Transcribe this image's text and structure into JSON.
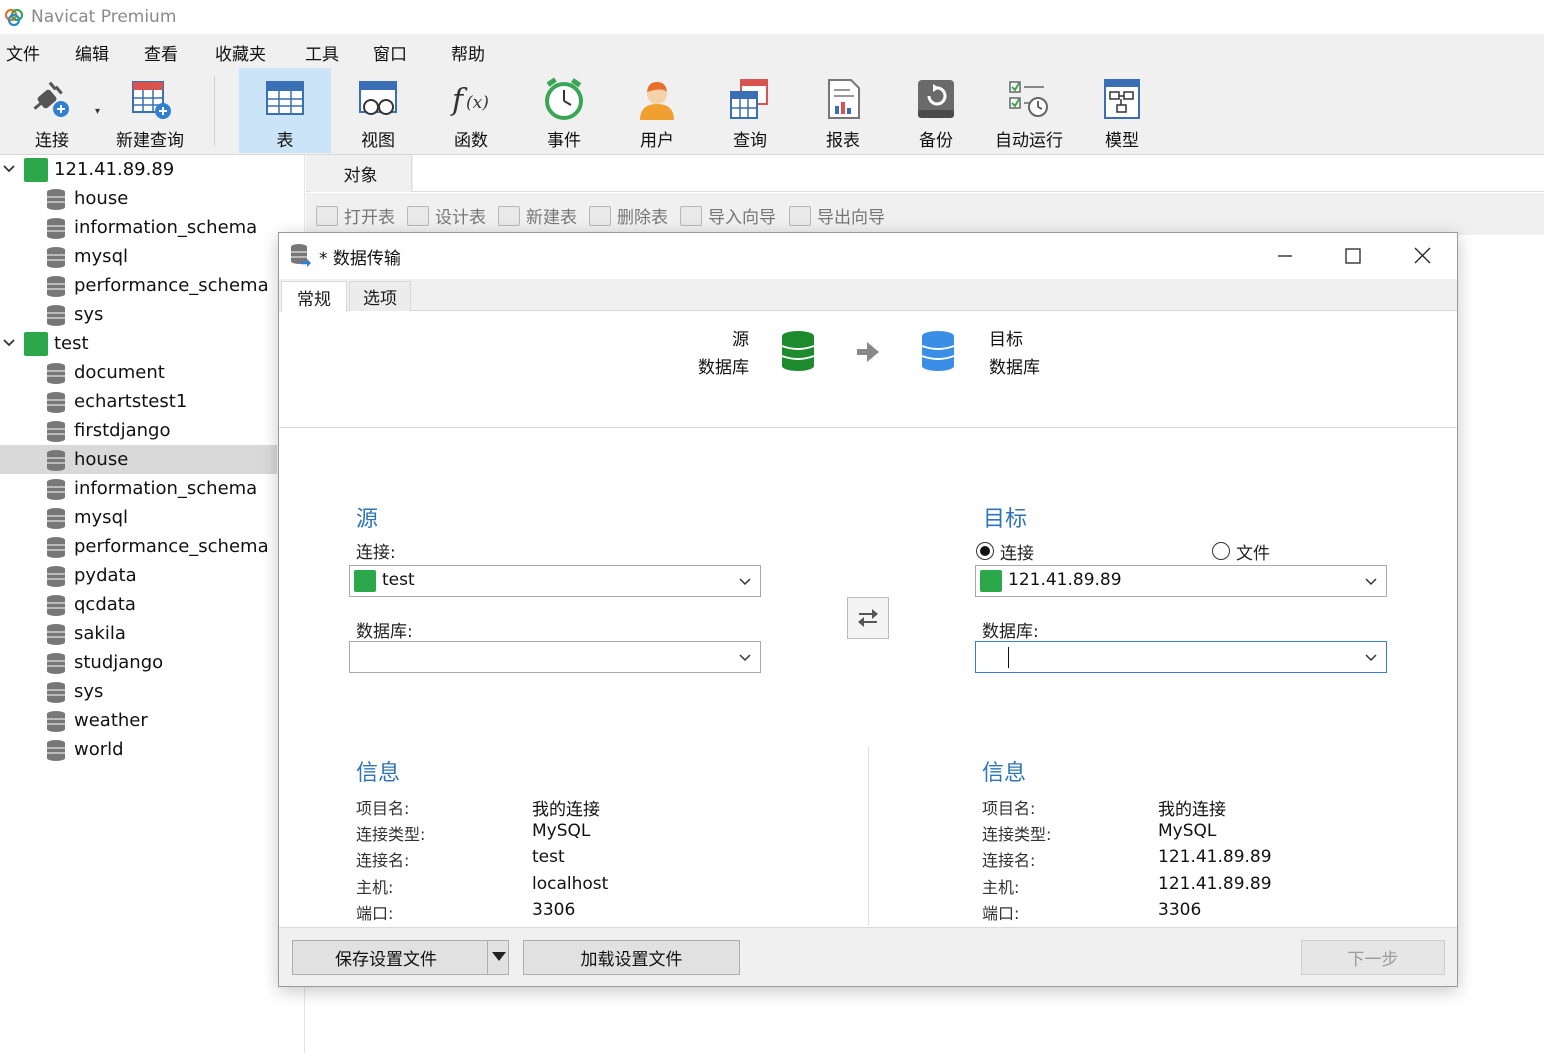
{
  "app": {
    "title": "Navicat Premium"
  },
  "menu": [
    "文件",
    "编辑",
    "查看",
    "收藏夹",
    "工具",
    "窗口",
    "帮助"
  ],
  "toolbar": {
    "items": [
      {
        "label": "连接",
        "icon": "plug-connect-icon"
      },
      {
        "label": "新建查询",
        "icon": "new-query-icon"
      },
      {
        "label": "表",
        "icon": "table-icon",
        "active": true
      },
      {
        "label": "视图",
        "icon": "view-icon"
      },
      {
        "label": "函数",
        "icon": "function-icon"
      },
      {
        "label": "事件",
        "icon": "alarm-clock-icon"
      },
      {
        "label": "用户",
        "icon": "user-icon"
      },
      {
        "label": "查询",
        "icon": "query-icon"
      },
      {
        "label": "报表",
        "icon": "report-icon"
      },
      {
        "label": "备份",
        "icon": "backup-icon"
      },
      {
        "label": "自动运行",
        "icon": "automation-icon"
      },
      {
        "label": "模型",
        "icon": "model-icon"
      }
    ]
  },
  "sidebar": {
    "connections": [
      {
        "name": "121.41.89.89",
        "databases": [
          "house",
          "information_schema",
          "mysql",
          "performance_schema",
          "sys"
        ]
      },
      {
        "name": "test",
        "databases": [
          "document",
          "echartstest1",
          "firstdjango",
          "house",
          "information_schema",
          "mysql",
          "performance_schema",
          "pydata",
          "qcdata",
          "sakila",
          "studjango",
          "sys",
          "weather",
          "world"
        ],
        "selected": "house"
      }
    ]
  },
  "objects": {
    "tab": "对象",
    "actions": [
      "打开表",
      "设计表",
      "新建表",
      "删除表",
      "导入向导",
      "导出向导"
    ]
  },
  "dialog": {
    "title": "* 数据传输",
    "tabs": [
      "常规",
      "选项"
    ],
    "header": {
      "source_line1": "源",
      "source_line2": "数据库",
      "target_line1": "目标",
      "target_line2": "数据库"
    },
    "source": {
      "title": "源",
      "connection_label": "连接:",
      "connection_value": "test",
      "database_label": "数据库:",
      "database_value": ""
    },
    "target": {
      "title": "目标",
      "radio_connection": "连接",
      "radio_file": "文件",
      "connection_value": "121.41.89.89",
      "database_label": "数据库:",
      "database_value": ""
    },
    "info_source": {
      "title": "信息",
      "rows": [
        {
          "label": "项目名:",
          "value": "我的连接"
        },
        {
          "label": "连接类型:",
          "value": "MySQL"
        },
        {
          "label": "连接名:",
          "value": "test"
        },
        {
          "label": "主机:",
          "value": "localhost"
        },
        {
          "label": "端口:",
          "value": "3306"
        }
      ]
    },
    "info_target": {
      "title": "信息",
      "rows": [
        {
          "label": "项目名:",
          "value": "我的连接"
        },
        {
          "label": "连接类型:",
          "value": "MySQL"
        },
        {
          "label": "连接名:",
          "value": "121.41.89.89"
        },
        {
          "label": "主机:",
          "value": "121.41.89.89"
        },
        {
          "label": "端口:",
          "value": "3306"
        }
      ]
    },
    "footer": {
      "save_profile": "保存设置文件",
      "load_profile": "加载设置文件",
      "next": "下一步"
    }
  },
  "colors": {
    "accent": "#2e75b6",
    "mysql_green": "#2ba84a",
    "active_tool": "#cce4f7"
  }
}
